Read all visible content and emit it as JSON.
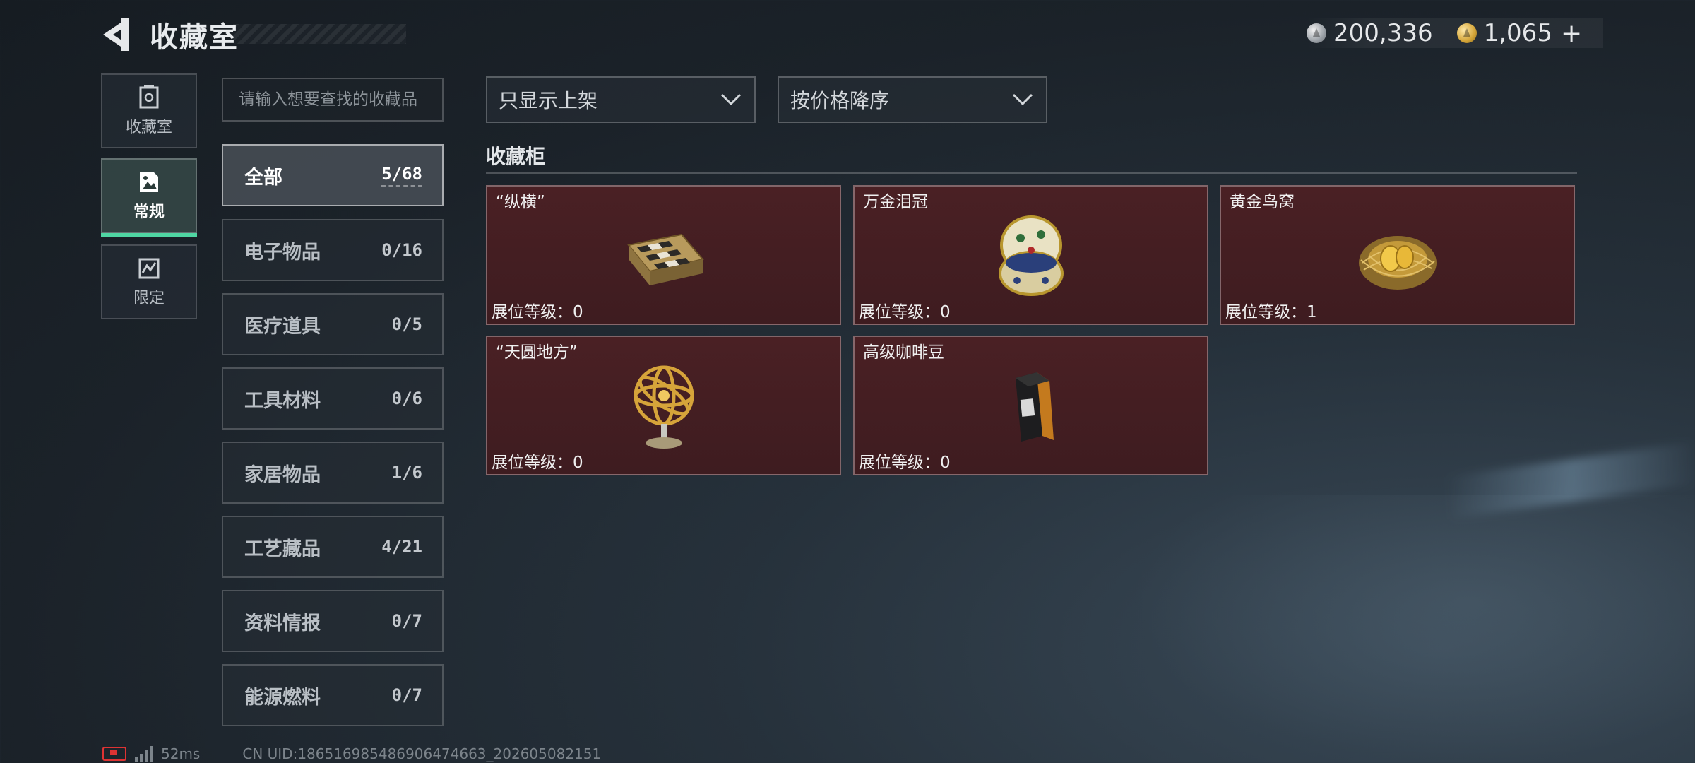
{
  "header": {
    "title": "收藏室",
    "currency": [
      {
        "icon": "silver-coin-icon",
        "value": "200,336"
      },
      {
        "icon": "gold-coin-icon",
        "value": "1,065"
      }
    ],
    "plus_label": "+"
  },
  "side_tabs": [
    {
      "label": "收藏室",
      "icon": "vault-icon",
      "active": false
    },
    {
      "label": "常规",
      "icon": "collection-icon",
      "active": true
    },
    {
      "label": "限定",
      "icon": "limited-icon",
      "active": false
    }
  ],
  "search": {
    "placeholder": "请输入想要查找的收藏品"
  },
  "categories": [
    {
      "name": "全部",
      "count": "5/68",
      "active": true
    },
    {
      "name": "电子物品",
      "count": "0/16"
    },
    {
      "name": "医疗道具",
      "count": "0/5"
    },
    {
      "name": "工具材料",
      "count": "0/6"
    },
    {
      "name": "家居物品",
      "count": "1/6"
    },
    {
      "name": "工艺藏品",
      "count": "4/21"
    },
    {
      "name": "资料情报",
      "count": "0/7"
    },
    {
      "name": "能源燃料",
      "count": "0/7"
    }
  ],
  "filters": {
    "shelf": "只显示上架",
    "sort": "按价格降序"
  },
  "section": {
    "title": "收藏柜"
  },
  "items": [
    {
      "name": "“纵横”",
      "level": "展位等级：0",
      "art": "chessboard-icon"
    },
    {
      "name": "万金泪冠",
      "level": "展位等级：0",
      "art": "jeweled-egg-icon"
    },
    {
      "name": "黄金鸟窝",
      "level": "展位等级：1",
      "art": "golden-nest-icon"
    },
    {
      "name": "“天圆地方”",
      "level": "展位等级：0",
      "art": "armillary-sphere-icon"
    },
    {
      "name": "高级咖啡豆",
      "level": "展位等级：0",
      "art": "coffee-bag-icon"
    }
  ],
  "footer": {
    "ping": "52ms",
    "uid": "CN UID:18651698548690647466​3_202605082151"
  },
  "colors": {
    "accent": "#4fd6a3",
    "card_bg": "#4a2024"
  }
}
